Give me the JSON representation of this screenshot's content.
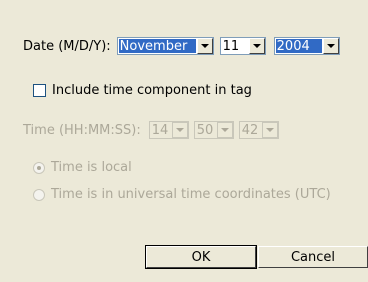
{
  "date": {
    "label": "Date (M/D/Y):",
    "month": "November",
    "day": "11",
    "year": "2004"
  },
  "include_time": {
    "label": "Include time component in tag",
    "checked": false
  },
  "time": {
    "label": "Time (HH:MM:SS):",
    "hours": "14",
    "minutes": "50",
    "seconds": "42"
  },
  "time_zone": {
    "local_label": "Time is local",
    "utc_label": "Time is in universal time coordinates (UTC)"
  },
  "buttons": {
    "ok": "OK",
    "cancel": "Cancel"
  }
}
